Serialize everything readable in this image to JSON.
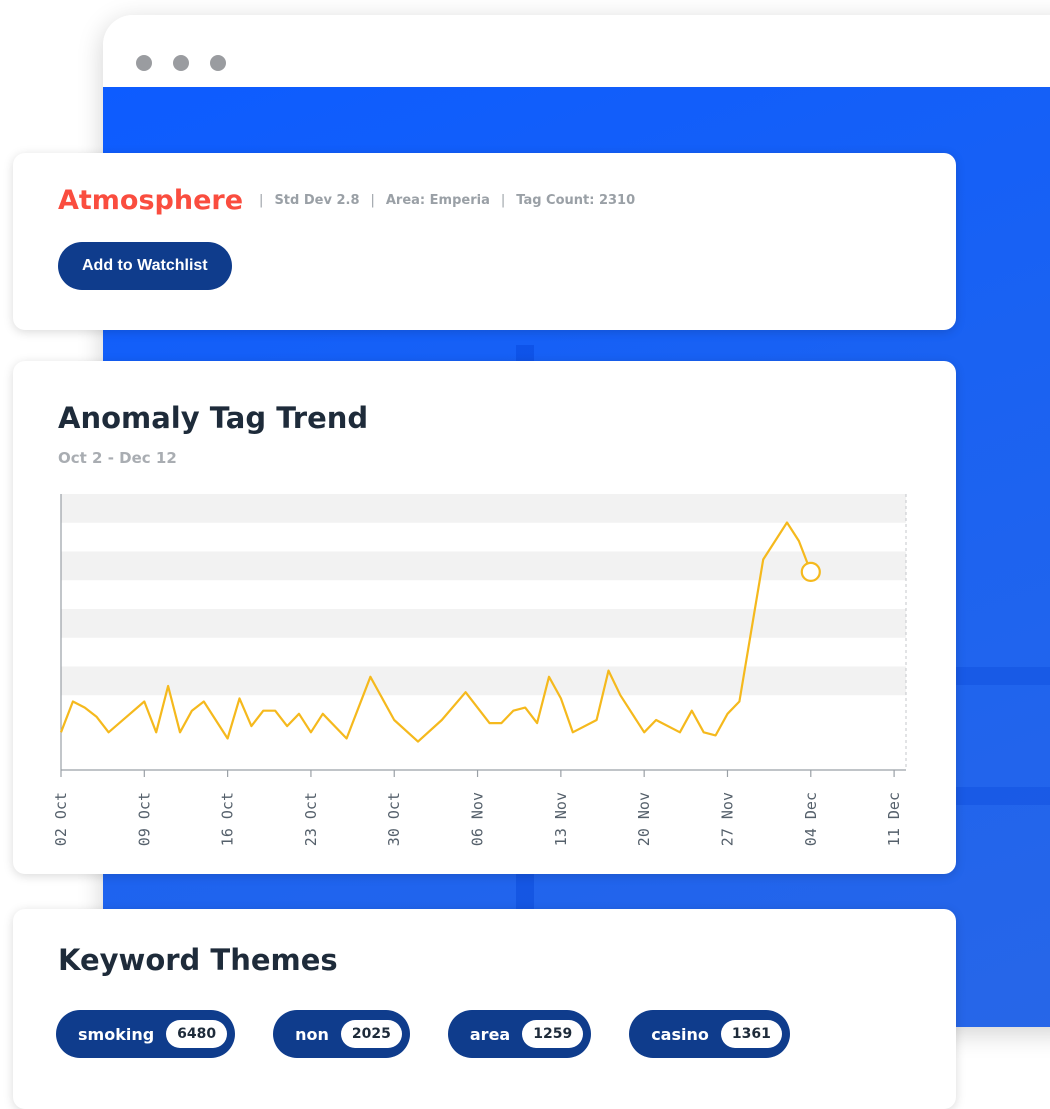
{
  "profile": {
    "title": "Atmosphere",
    "std_dev": "Std Dev 2.8",
    "area": "Area: Emperia",
    "tag_count": "Tag Count: 2310",
    "separator": "|",
    "watchlist_label": "Add to Watchlist"
  },
  "trend": {
    "title": "Anomaly Tag Trend",
    "subtitle": "Oct 2 - Dec 12"
  },
  "chart_data": {
    "type": "line",
    "title": "Anomaly Tag Trend",
    "subtitle": "Oct 2 - Dec 12",
    "xlabel": "",
    "ylabel": "",
    "grid": "horizontal banded",
    "x": [
      "02 Oct",
      "03 Oct",
      "04 Oct",
      "05 Oct",
      "06 Oct",
      "09 Oct",
      "10 Oct",
      "11 Oct",
      "12 Oct",
      "13 Oct",
      "14 Oct",
      "16 Oct",
      "17 Oct",
      "18 Oct",
      "19 Oct",
      "20 Oct",
      "21 Oct",
      "22 Oct",
      "23 Oct",
      "24 Oct",
      "26 Oct",
      "28 Oct",
      "30 Oct",
      "01 Nov",
      "03 Nov",
      "05 Nov",
      "07 Nov",
      "08 Nov",
      "09 Nov",
      "10 Nov",
      "11 Nov",
      "12 Nov",
      "13 Nov",
      "14 Nov",
      "16 Nov",
      "17 Nov",
      "18 Nov",
      "20 Nov",
      "21 Nov",
      "23 Nov",
      "24 Nov",
      "25 Nov",
      "26 Nov",
      "27 Nov",
      "28 Nov",
      "30 Nov",
      "02 Dec",
      "03 Dec",
      "04 Dec",
      "05 Dec",
      "06 Dec",
      "08 Dec",
      "09 Dec",
      "11 Dec",
      "12 Dec"
    ],
    "values": [
      0.8,
      1.8,
      1.6,
      1.3,
      0.8,
      1.8,
      0.8,
      2.3,
      0.8,
      1.5,
      1.8,
      0.6,
      1.9,
      1.0,
      1.5,
      1.5,
      1.0,
      1.4,
      0.8,
      1.4,
      0.6,
      2.6,
      1.2,
      0.5,
      1.2,
      2.1,
      1.1,
      1.1,
      1.5,
      1.6,
      1.1,
      2.6,
      1.9,
      0.8,
      1.2,
      2.8,
      2.0,
      0.8,
      1.2,
      0.8,
      1.5,
      0.8,
      0.7,
      1.4,
      1.8,
      6.4,
      7.6,
      7.0,
      6.0
    ],
    "x_ticks": [
      "02 Oct",
      "09 Oct",
      "16 Oct",
      "23 Oct",
      "30 Oct",
      "06 Nov",
      "13 Nov",
      "20 Nov",
      "27 Nov",
      "04 Dec",
      "11 Dec"
    ],
    "ylim": [
      0,
      8.2
    ]
  },
  "keywords": {
    "title": "Keyword Themes",
    "items": [
      {
        "label": "smoking",
        "count": "6480"
      },
      {
        "label": "non",
        "count": "2025"
      },
      {
        "label": "area",
        "count": "1259"
      },
      {
        "label": "casino",
        "count": "1361"
      }
    ]
  },
  "colors": {
    "accent_red": "#fa4d3f",
    "button_navy": "#0f3c8c",
    "line": "#f5b91d",
    "browser_blue": "#0d5cff"
  }
}
